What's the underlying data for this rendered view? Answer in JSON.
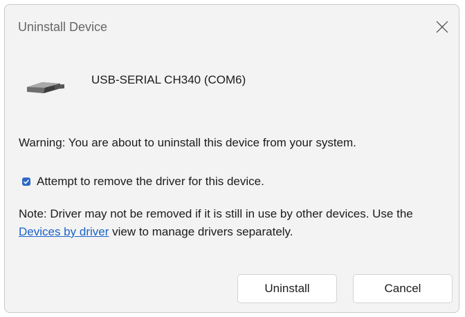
{
  "dialog": {
    "title": "Uninstall Device",
    "close_icon": "close-icon",
    "device_icon": "usb-serial-device-icon",
    "device_name": "USB-SERIAL CH340 (COM6)",
    "warning": "Warning: You are about to uninstall this device from your system.",
    "checkbox": {
      "label": "Attempt to remove the driver for this device.",
      "checked": true
    },
    "note": {
      "before_link": "Note: Driver may not be removed if it is still in use by other devices. Use the ",
      "link_text": "Devices by driver",
      "after_link": " view to manage drivers separately."
    },
    "buttons": {
      "uninstall": "Uninstall",
      "cancel": "Cancel"
    }
  },
  "colors": {
    "accent": "#2f67c5",
    "link": "#1a63c8",
    "dialog_background": "#f3f3f3"
  }
}
